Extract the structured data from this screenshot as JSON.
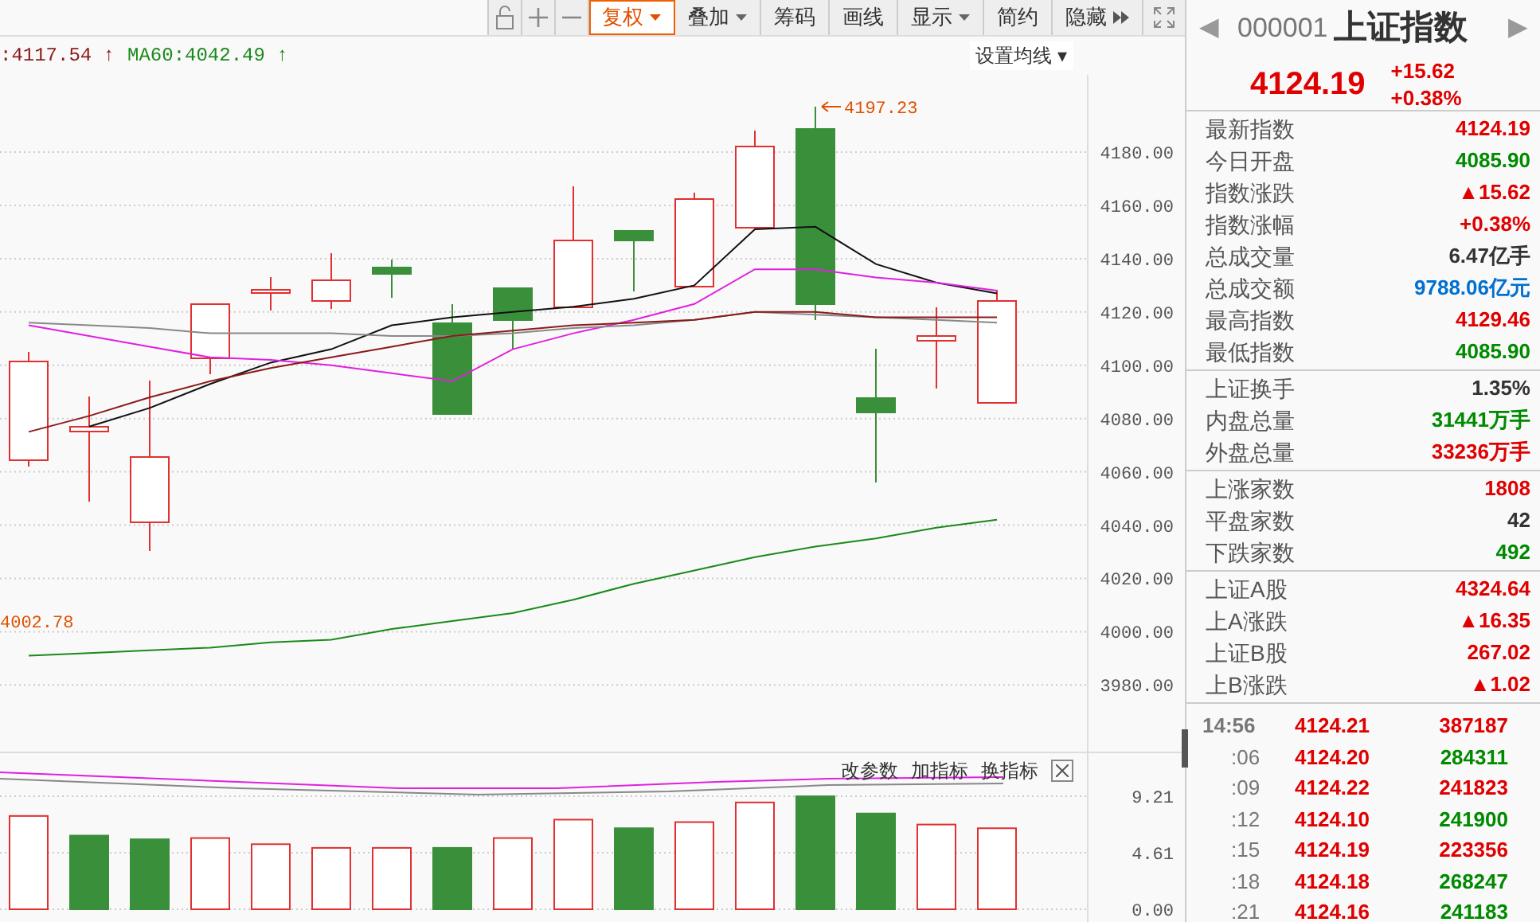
{
  "toolbar": [
    {
      "label": "复权",
      "kind": "menu",
      "selected": true
    },
    {
      "label": "叠加",
      "kind": "menu",
      "selected": false
    },
    {
      "label": "筹码",
      "kind": "plain",
      "selected": false
    },
    {
      "label": "画线",
      "kind": "plain",
      "selected": false
    },
    {
      "label": "显示",
      "kind": "menu",
      "selected": false
    },
    {
      "label": "简约",
      "kind": "plain",
      "selected": false
    },
    {
      "label": "隐藏",
      "kind": "expand",
      "selected": false
    }
  ],
  "legend": [
    {
      "text": ":4117.54",
      "arrow": "↑",
      "color": "#8b1a1a"
    },
    {
      "text": "MA60:4042.49",
      "arrow": "↑",
      "color": "#1a8a1a"
    }
  ],
  "ma_settings": {
    "label": "设置均线",
    "caret": "▾"
  },
  "price_chart": {
    "high_marker": "4197.23",
    "low_marker": "4002.78",
    "candle_rising": [
      true,
      true,
      true,
      true,
      true,
      true,
      false,
      false,
      false,
      true,
      false,
      true,
      true,
      false,
      false,
      true,
      true
    ],
    "chart_data": {
      "type": "line",
      "grid": true,
      "ylim": [
        3955,
        4209
      ],
      "yticks": [
        {
          "value": 4180,
          "label": "4180.00"
        },
        {
          "value": 4160,
          "label": "4160.00"
        },
        {
          "value": 4140,
          "label": "4140.00"
        },
        {
          "value": 4120,
          "label": "4120.00"
        },
        {
          "value": 4100,
          "label": "4100.00"
        },
        {
          "value": 4080,
          "label": "4080.00"
        },
        {
          "value": 4060,
          "label": "4060.00"
        },
        {
          "value": 4040,
          "label": "4040.00"
        },
        {
          "value": 4020,
          "label": "4020.00"
        },
        {
          "value": 4000,
          "label": "4000.00"
        },
        {
          "value": 3980,
          "label": "3980.00"
        }
      ],
      "series": [
        {
          "color": "#111111",
          "values": [
            null,
            4077,
            4084,
            4093,
            4101,
            4106,
            4115,
            4118,
            4120,
            4122,
            4125,
            4130,
            4151,
            4152,
            4138,
            4131,
            4127
          ]
        },
        {
          "color": "#e020e0",
          "values": [
            4115,
            4111,
            4107,
            4103,
            4102,
            4100,
            4097,
            4094,
            4106,
            4112,
            4117,
            4123,
            4136,
            4136,
            4133,
            4131,
            4128
          ]
        },
        {
          "color": "#888888",
          "values": [
            4116,
            4115,
            4114,
            4112,
            4112,
            4112,
            4111,
            4111,
            4112,
            4114,
            4115,
            4117,
            4120,
            4119,
            4118,
            4117,
            4116
          ]
        },
        {
          "color": "#8b1a1a",
          "values": [
            4075,
            4081,
            4088,
            4094,
            4099,
            4103,
            4107,
            4111,
            4113,
            4115,
            4116,
            4117,
            4120,
            4120,
            4118,
            4118,
            4118
          ]
        },
        {
          "color": "#1a8a1a",
          "values": [
            3991,
            3992,
            3993,
            3994,
            3996,
            3997,
            4001,
            4004,
            4007,
            4012,
            4018,
            4023,
            4028,
            4032,
            4035,
            4039,
            4042
          ]
        }
      ]
    }
  },
  "indicator_buttons": [
    "改参数",
    "加指标",
    "换指标"
  ],
  "volume_chart": {
    "bar_rising": [
      true,
      false,
      false,
      true,
      true,
      true,
      true,
      false,
      true,
      true,
      false,
      true,
      true,
      false,
      false,
      true,
      true
    ],
    "chart_data": {
      "type": "bar",
      "grid": true,
      "ylim": [
        0,
        9.21
      ],
      "yticks": [
        {
          "value": 0,
          "label": "0.00"
        },
        {
          "value": 4.61,
          "label": "4.61"
        },
        {
          "value": 9.21,
          "label": "9.21"
        }
      ],
      "series": [
        {
          "values": [
            7.6,
            6.0,
            5.7,
            5.8,
            5.3,
            5.0,
            5.0,
            5.0,
            5.8,
            7.3,
            6.6,
            7.1,
            8.7,
            9.2,
            7.8,
            6.9,
            6.6
          ]
        }
      ]
    }
  },
  "quote": {
    "prev": "◀",
    "next": "▶",
    "code": "000001",
    "name": "上证指数",
    "price": "4124.19",
    "change": "+15.62",
    "change_pct": "+0.38%"
  },
  "stats": [
    [
      {
        "label": "最新指数",
        "value": "4124.19",
        "color": "#e00000"
      },
      {
        "label": "今日开盘",
        "value": "4085.90",
        "color": "#008a00"
      },
      {
        "label": "指数涨跌",
        "value": "▲15.62",
        "color": "#e00000"
      },
      {
        "label": "指数涨幅",
        "value": "+0.38%",
        "color": "#e00000"
      },
      {
        "label": "总成交量",
        "value": "6.47亿手",
        "color": "#333333"
      },
      {
        "label": "总成交额",
        "value": "9788.06亿元",
        "color": "#0070d0"
      },
      {
        "label": "最高指数",
        "value": "4129.46",
        "color": "#e00000"
      },
      {
        "label": "最低指数",
        "value": "4085.90",
        "color": "#008a00"
      }
    ],
    [
      {
        "label": "上证换手",
        "value": "1.35%",
        "color": "#333333"
      },
      {
        "label": "内盘总量",
        "value": "31441万手",
        "color": "#008a00"
      },
      {
        "label": "外盘总量",
        "value": "33236万手",
        "color": "#e00000"
      }
    ],
    [
      {
        "label": "上涨家数",
        "value": "1808",
        "color": "#e00000"
      },
      {
        "label": "平盘家数",
        "value": "42",
        "color": "#333333"
      },
      {
        "label": "下跌家数",
        "value": "492",
        "color": "#008a00"
      }
    ],
    [
      {
        "label": "上证A股",
        "value": "4324.64",
        "color": "#e00000"
      },
      {
        "label": "上A涨跌",
        "value": "▲16.35",
        "color": "#e00000"
      },
      {
        "label": "上证B股",
        "value": "267.02",
        "color": "#e00000"
      },
      {
        "label": "上B涨跌",
        "value": "▲1.02",
        "color": "#e00000"
      }
    ]
  ],
  "ticks": [
    {
      "time": "14:56",
      "price": "4124.21",
      "volume": "387187",
      "color": "#e00000"
    },
    {
      "time": ":06",
      "price": "4124.20",
      "volume": "284311",
      "color": "#008a00"
    },
    {
      "time": ":09",
      "price": "4124.22",
      "volume": "241823",
      "color": "#e00000"
    },
    {
      "time": ":12",
      "price": "4124.10",
      "volume": "241900",
      "color": "#008a00"
    },
    {
      "time": ":15",
      "price": "4124.19",
      "volume": "223356",
      "color": "#e00000"
    },
    {
      "time": ":18",
      "price": "4124.18",
      "volume": "268247",
      "color": "#008a00"
    },
    {
      "time": ":21",
      "price": "4124.16",
      "volume": "241183",
      "color": "#008a00"
    }
  ]
}
